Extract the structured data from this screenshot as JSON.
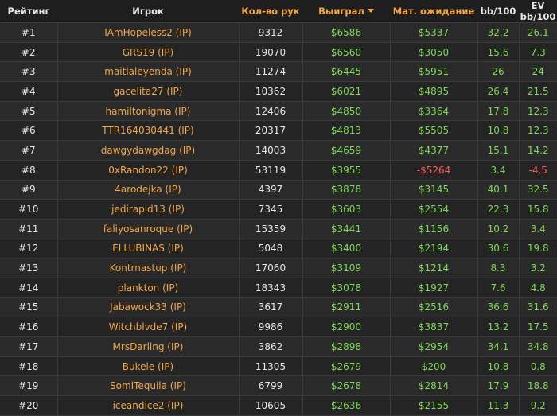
{
  "colors": {
    "positive": "#7ed957",
    "negative": "#ff5b5b",
    "accent": "#f3a64a"
  },
  "headers": {
    "rank": "Рейтинг",
    "player": "Игрок",
    "hands": "Кол-во рук",
    "won": "Выиграл",
    "ev": "Мат. ожидание",
    "bb100": "bb/100",
    "evbb100": "EV bb/100"
  },
  "sort_icon": "caret-down-icon",
  "rows": [
    {
      "rank": "#1",
      "player": "IAmHopeless2 (IP)",
      "hands": "9312",
      "won": "$6586",
      "ev": "$5337",
      "bb100": "32.2",
      "evbb100": "26.1"
    },
    {
      "rank": "#2",
      "player": "GRS19 (IP)",
      "hands": "19070",
      "won": "$6560",
      "ev": "$3050",
      "bb100": "15.6",
      "evbb100": "7.3"
    },
    {
      "rank": "#3",
      "player": "maitlaleyenda (IP)",
      "hands": "11274",
      "won": "$6445",
      "ev": "$5951",
      "bb100": "26",
      "evbb100": "24"
    },
    {
      "rank": "#4",
      "player": "gacelita27 (IP)",
      "hands": "10362",
      "won": "$6021",
      "ev": "$4895",
      "bb100": "26.4",
      "evbb100": "21.5"
    },
    {
      "rank": "#5",
      "player": "hamiltonigma (IP)",
      "hands": "12406",
      "won": "$4850",
      "ev": "$3364",
      "bb100": "17.8",
      "evbb100": "12.3"
    },
    {
      "rank": "#6",
      "player": "TTR164030441 (IP)",
      "hands": "20317",
      "won": "$4813",
      "ev": "$5505",
      "bb100": "10.8",
      "evbb100": "12.3"
    },
    {
      "rank": "#7",
      "player": "dawgydawgdag (IP)",
      "hands": "14003",
      "won": "$4659",
      "ev": "$4377",
      "bb100": "15.1",
      "evbb100": "14.2"
    },
    {
      "rank": "#8",
      "player": "0xRandon22 (IP)",
      "hands": "53119",
      "won": "$3955",
      "ev": "-$5264",
      "bb100": "3.4",
      "evbb100": "-4.5"
    },
    {
      "rank": "#9",
      "player": "4arodejka (IP)",
      "hands": "4397",
      "won": "$3878",
      "ev": "$3145",
      "bb100": "40.1",
      "evbb100": "32.5"
    },
    {
      "rank": "#10",
      "player": "jedirapid13 (IP)",
      "hands": "7345",
      "won": "$3603",
      "ev": "$2554",
      "bb100": "22.3",
      "evbb100": "15.8"
    },
    {
      "rank": "#11",
      "player": "faliyosanroque (IP)",
      "hands": "15359",
      "won": "$3441",
      "ev": "$1156",
      "bb100": "10.2",
      "evbb100": "3.4"
    },
    {
      "rank": "#12",
      "player": "ELLUBINAS (IP)",
      "hands": "5048",
      "won": "$3400",
      "ev": "$2194",
      "bb100": "30.6",
      "evbb100": "19.8"
    },
    {
      "rank": "#13",
      "player": "Kontrnastup (IP)",
      "hands": "17060",
      "won": "$3109",
      "ev": "$1214",
      "bb100": "8.3",
      "evbb100": "3.2"
    },
    {
      "rank": "#14",
      "player": "plankton (IP)",
      "hands": "18343",
      "won": "$3078",
      "ev": "$1927",
      "bb100": "7.6",
      "evbb100": "4.8"
    },
    {
      "rank": "#15",
      "player": "Jabawock33 (IP)",
      "hands": "3617",
      "won": "$2911",
      "ev": "$2516",
      "bb100": "36.6",
      "evbb100": "31.6"
    },
    {
      "rank": "#16",
      "player": "Witchblvde7 (IP)",
      "hands": "9986",
      "won": "$2900",
      "ev": "$3837",
      "bb100": "13.2",
      "evbb100": "17.5"
    },
    {
      "rank": "#17",
      "player": "MrsDarling (IP)",
      "hands": "3862",
      "won": "$2898",
      "ev": "$2954",
      "bb100": "34.1",
      "evbb100": "34.8"
    },
    {
      "rank": "#18",
      "player": "Bukele (IP)",
      "hands": "11305",
      "won": "$2679",
      "ev": "$200",
      "bb100": "10.8",
      "evbb100": "0.8"
    },
    {
      "rank": "#19",
      "player": "SomiTequila (IP)",
      "hands": "6799",
      "won": "$2678",
      "ev": "$2814",
      "bb100": "17.9",
      "evbb100": "18.8"
    },
    {
      "rank": "#20",
      "player": "iceandice2 (IP)",
      "hands": "10605",
      "won": "$2636",
      "ev": "$2155",
      "bb100": "11.3",
      "evbb100": "9.2"
    }
  ]
}
